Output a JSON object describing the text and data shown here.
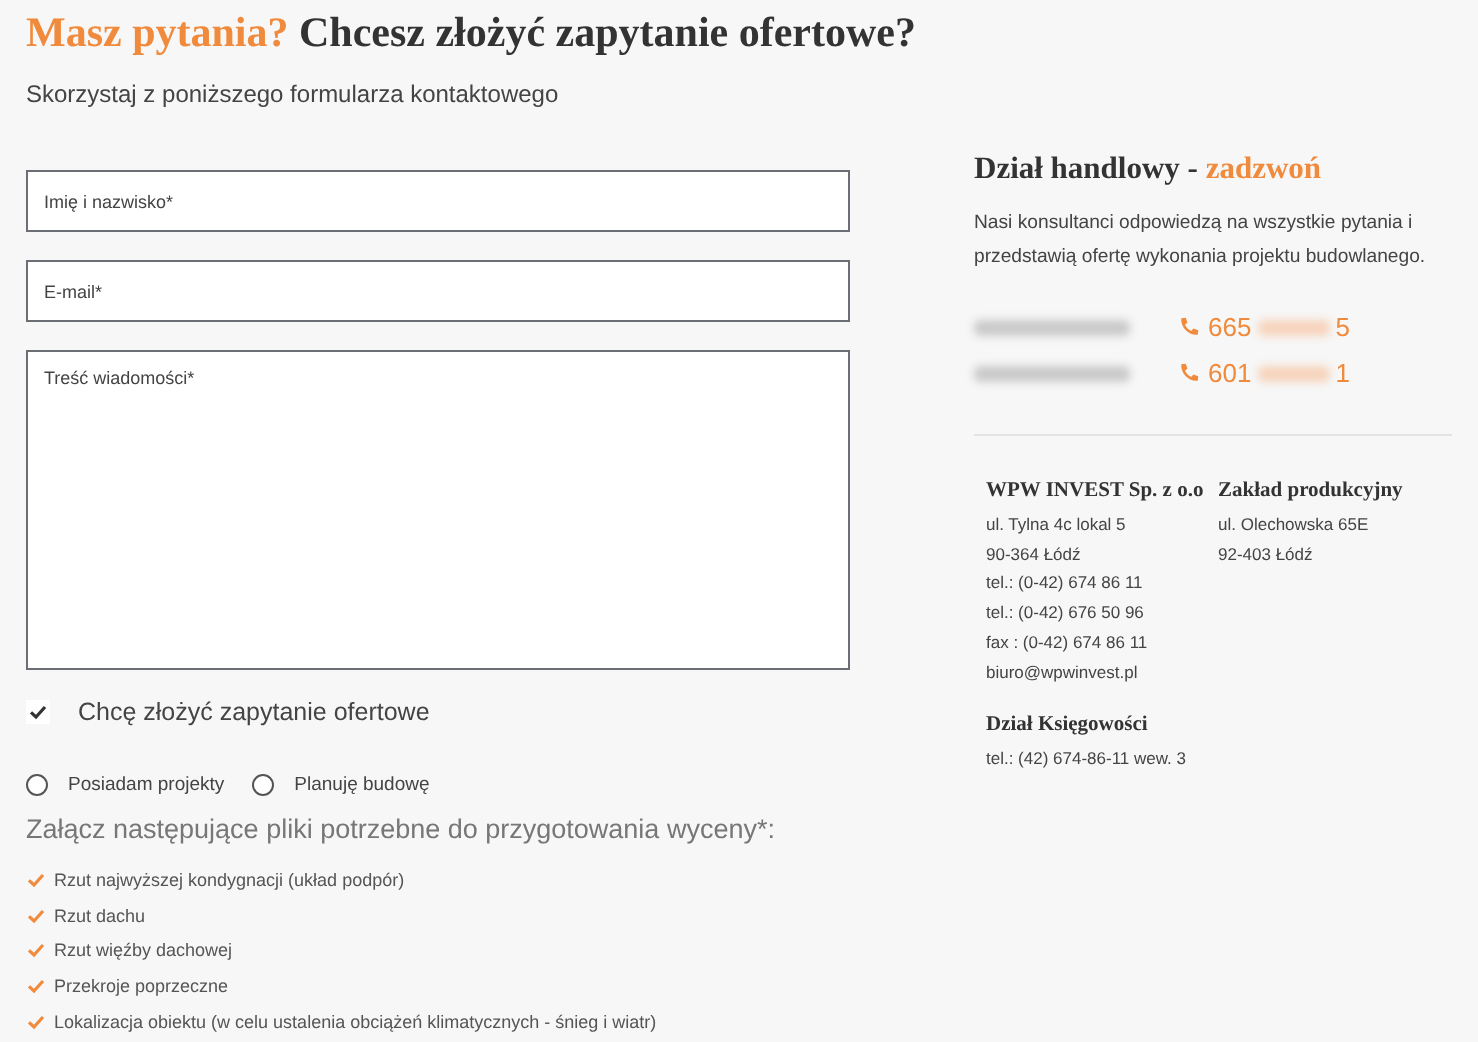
{
  "heading": {
    "highlight": "Masz pytania?",
    "text": "Chcesz złożyć zapytanie ofertowe?"
  },
  "subheading": "Skorzystaj z poniższego formularza kontaktowego",
  "form": {
    "fields": [
      {
        "kind": "input",
        "placeholder": "Imię i nazwisko*"
      },
      {
        "kind": "input",
        "placeholder": "E-mail*"
      },
      {
        "kind": "textarea",
        "placeholder": "Treść wiadomości*"
      }
    ],
    "checkbox": {
      "label": "Chcę złożyć zapytanie ofertowe",
      "checked": true
    },
    "radios": [
      {
        "label": "Posiadam projekty",
        "selected": false
      },
      {
        "label": "Planuję budowę",
        "selected": false
      }
    ],
    "attachments_heading": "Załącz następujące pliki potrzebne do przygotowania wyceny*:",
    "attachments": [
      "Rzut najwyższej kondygnacji (układ podpór)",
      "Rzut dachu",
      "Rzut więźby dachowej",
      "Przekroje poprzeczne",
      "Lokalizacja obiektu (w celu ustalenia obciążeń klimatycznych - śnieg i wiatr)"
    ]
  },
  "sales": {
    "title": "Dział handlowy -",
    "title_highlight": "zadzwoń",
    "description": "Nasi konsultanci odpowiedzą na wszystkie pytania i przedstawią ofertę wykonania projektu budowlanego.",
    "contacts": [
      {
        "phone_start": "665",
        "phone_end": "5"
      },
      {
        "phone_start": "601",
        "phone_end": "1"
      }
    ]
  },
  "offices": [
    {
      "name": "WPW INVEST Sp. z o.o",
      "lines": [
        "ul. Tylna 4c lokal 5",
        "90-364 Łódź",
        "tel.: (0-42) 674 86 11",
        "tel.: (0-42) 676 50 96",
        "fax : (0-42) 674 86 11",
        "biuro@wpwinvest.pl"
      ]
    },
    {
      "name": "Zakład produkcyjny",
      "lines": [
        "ul. Olechowska 65E",
        "92-403 Łódź"
      ]
    },
    {
      "name": "Dział Księgowości",
      "lines": [
        "tel.: (42) 674-86-11 wew. 3"
      ]
    }
  ]
}
